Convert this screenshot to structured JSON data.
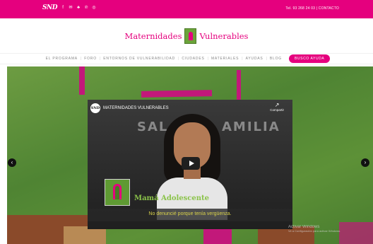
{
  "topbar": {
    "logo": "SND",
    "social": [
      "f",
      "✉",
      "♣",
      "℗",
      "◎"
    ],
    "contact": "Tel. 93 268 24 03 | CONTACTO"
  },
  "brand": {
    "left_word": "Maternidades",
    "right_word": "Vulnerables"
  },
  "nav": {
    "items": [
      "EL PROGRAMA",
      "FORO",
      "ENTORNOS DE VULNERABILIDAD",
      "CIUDADES",
      "MATERIALES",
      "AYUDAS",
      "BLOG"
    ],
    "cta": "BUSCO AYUDA"
  },
  "video": {
    "channel": "SND",
    "title": "MATERNIDADES VULNERABLES",
    "share_icon": "↗",
    "share_label": "Compartir",
    "sign_left": "SAL",
    "sign_right": "AMILIA",
    "badge_text": "Mamá Adolescente",
    "caption": "No denuncié porque tenía vergüenza."
  },
  "watermark": {
    "line1": "Activar Windows",
    "line2": "Ve a Configuración para activar Windows."
  },
  "carousel": {
    "prev": "‹",
    "next": "›"
  },
  "colors": {
    "accent": "#e5007e",
    "green": "#5f9a33"
  }
}
